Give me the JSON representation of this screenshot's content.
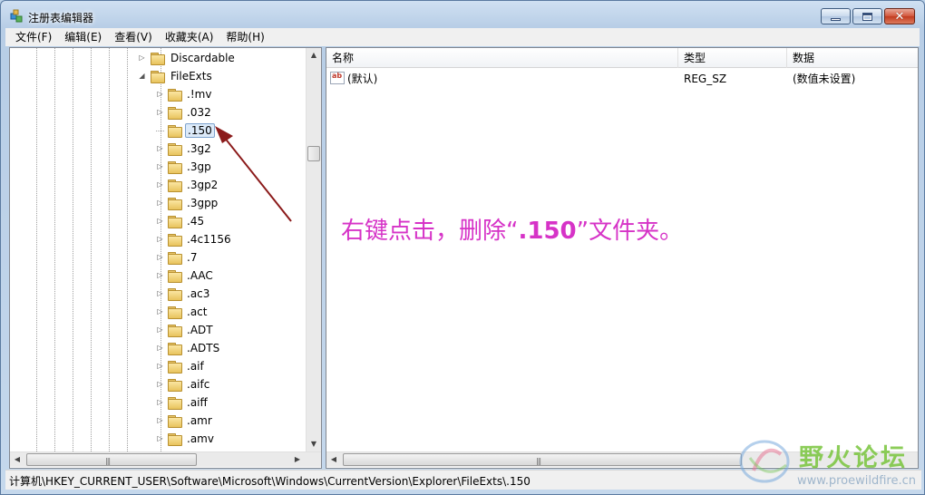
{
  "window": {
    "title": "注册表编辑器",
    "controls": {
      "minimize": "minimize",
      "maximize": "maximize",
      "close": "✕"
    }
  },
  "menu": [
    "文件(F)",
    "编辑(E)",
    "查看(V)",
    "收藏夹(A)",
    "帮助(H)"
  ],
  "tree": {
    "parents": [
      {
        "label": "Discardable",
        "expander": "▷"
      },
      {
        "label": "FileExts",
        "expander": "◢"
      }
    ],
    "children": [
      {
        "label": ".!mv",
        "expander": "▷"
      },
      {
        "label": ".032",
        "expander": "▷"
      },
      {
        "label": ".150",
        "expander": "",
        "selected": true
      },
      {
        "label": ".3g2",
        "expander": "▷"
      },
      {
        "label": ".3gp",
        "expander": "▷"
      },
      {
        "label": ".3gp2",
        "expander": "▷"
      },
      {
        "label": ".3gpp",
        "expander": "▷"
      },
      {
        "label": ".45",
        "expander": "▷"
      },
      {
        "label": ".4c1156",
        "expander": "▷"
      },
      {
        "label": ".7",
        "expander": "▷"
      },
      {
        "label": ".AAC",
        "expander": "▷"
      },
      {
        "label": ".ac3",
        "expander": "▷"
      },
      {
        "label": ".act",
        "expander": "▷"
      },
      {
        "label": ".ADT",
        "expander": "▷"
      },
      {
        "label": ".ADTS",
        "expander": "▷"
      },
      {
        "label": ".aif",
        "expander": "▷"
      },
      {
        "label": ".aifc",
        "expander": "▷"
      },
      {
        "label": ".aiff",
        "expander": "▷"
      },
      {
        "label": ".amr",
        "expander": "▷"
      },
      {
        "label": ".amv",
        "expander": "▷"
      }
    ]
  },
  "list": {
    "columns": [
      "名称",
      "类型",
      "数据"
    ],
    "rows": [
      {
        "name": "(默认)",
        "type": "REG_SZ",
        "data": "(数值未设置)",
        "icon": "ab"
      }
    ]
  },
  "annotation": {
    "before": "右键点击，删除“",
    "highlight": ".150",
    "after": "”文件夹。",
    "color": "#d633c7"
  },
  "statusbar": {
    "path": "计算机\\HKEY_CURRENT_USER\\Software\\Microsoft\\Windows\\CurrentVersion\\Explorer\\FileExts\\.150"
  },
  "watermark": {
    "title": "野火论坛",
    "url": "www.proewildfire.cn"
  },
  "scroll": {
    "left": "◀",
    "right": "▶",
    "up": "▲",
    "down": "▼",
    "grip": "|||"
  }
}
